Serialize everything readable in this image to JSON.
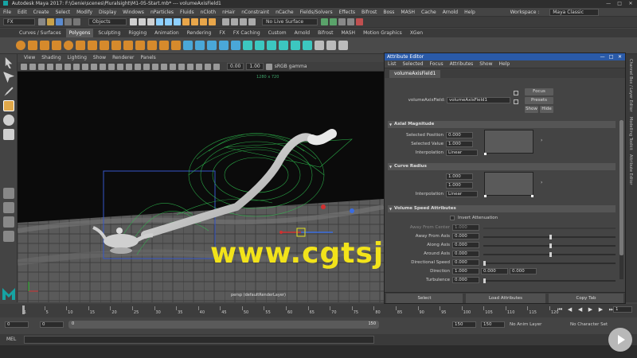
{
  "window": {
    "title": "Autodesk Maya 2017: F:\\Genie\\scenes\\Pluralsight\\M1-05-Start.mb*  ---  volumeAxisField1"
  },
  "menubar": {
    "items": [
      "File",
      "Edit",
      "Create",
      "Select",
      "Modify",
      "Display",
      "Windows",
      "nParticles",
      "Fluids",
      "nCloth",
      "nHair",
      "nConstraint",
      "nCache",
      "Fields/Solvers",
      "Effects",
      "Bifrost",
      "Boss",
      "MASH",
      "Cache",
      "Arnold",
      "Help"
    ],
    "workspace_label": "Workspace :",
    "workspace_value": "Maya Classic"
  },
  "statusline": {
    "mode": "FX",
    "select_mode": "Objects",
    "live_surface": "No Live Surface"
  },
  "shelf": {
    "tabs": [
      "Curves / Surfaces",
      "Polygons",
      "Sculpting",
      "Rigging",
      "Animation",
      "Rendering",
      "FX",
      "FX Caching",
      "Custom",
      "Arnold",
      "Bifrost",
      "MASH",
      "Motion Graphics",
      "XGen"
    ],
    "active": "Polygons"
  },
  "viewport": {
    "menu": [
      "View",
      "Shading",
      "Lighting",
      "Show",
      "Renderer",
      "Panels"
    ],
    "near_clip": "0.00",
    "far_clip": "1.00",
    "color_space": "sRGB gamma",
    "resolution": "1280 x 720",
    "camera": "persp (defaultRenderLayer)",
    "watermark": "www.cgtsj.com"
  },
  "channel_box_tabs": [
    "Channel Box / Layer Editor",
    "Modelling Toolkit",
    "Attribute Editor"
  ],
  "attribute_editor": {
    "title": "Attribute Editor",
    "menu": [
      "List",
      "Selected",
      "Focus",
      "Attributes",
      "Show",
      "Help"
    ],
    "tab": "volumeAxisField1",
    "node_label": "volumeAxisField:",
    "node_value": "volumeAxisField1",
    "buttons": {
      "focus": "Focus",
      "presets": "Presets",
      "show": "Show",
      "hide": "Hide"
    },
    "axial_magnitude": {
      "header": "Axial Magnitude",
      "selected_position_label": "Selected Position",
      "selected_position": "0.000",
      "selected_value_label": "Selected Value",
      "selected_value": "1.000",
      "interpolation_label": "Interpolation",
      "interpolation": "Linear"
    },
    "curve_radius": {
      "header": "Curve Radius",
      "selected_position": "1.000",
      "selected_value": "1.000",
      "interpolation_label": "Interpolation",
      "interpolation": "Linear"
    },
    "volume_speed": {
      "header": "Volume Speed Attributes",
      "invert_attenuation_label": "Invert Attenuation",
      "away_from_center_label": "Away From Center",
      "away_from_center": "1.000",
      "away_from_axis_label": "Away From Axis",
      "away_from_axis": "0.000",
      "along_axis_label": "Along Axis",
      "along_axis": "0.000",
      "around_axis_label": "Around Axis",
      "around_axis": "0.000",
      "directional_speed_label": "Directional Speed",
      "directional_speed": "0.000",
      "direction_label": "Direction",
      "direction": [
        "1.000",
        "0.000",
        "0.000"
      ],
      "turbulence_label": "Turbulence",
      "turbulence": "0.000",
      "slider_levels": {
        "away_from_axis": 0.5,
        "along_axis": 0.5,
        "around_axis": 0.5,
        "directional_speed": 0.0,
        "turbulence": 0.0
      }
    },
    "footer": {
      "select": "Select",
      "load": "Load Attributes",
      "copy": "Copy Tab"
    }
  },
  "timeline": {
    "ticks": [
      "1",
      "5",
      "10",
      "15",
      "20",
      "25",
      "30",
      "35",
      "40",
      "45",
      "50",
      "55",
      "60",
      "65",
      "70",
      "75",
      "80",
      "85",
      "90",
      "95",
      "100",
      "105",
      "110",
      "115",
      "120"
    ],
    "current_frame": "1",
    "range_start": "0",
    "range_inner_start": "0",
    "range_inner_end": "150",
    "range_end": "150",
    "range_end_2": "150",
    "anim_layer": "No Anim Layer",
    "character_set": "No Character Set"
  },
  "mel": {
    "label": "MEL"
  },
  "colors": {
    "ae_title": "#2a5aa8",
    "watermark": "#f2e31a",
    "maya_accent": "#16a3a3",
    "shelf_orange": "#d68a2c"
  }
}
